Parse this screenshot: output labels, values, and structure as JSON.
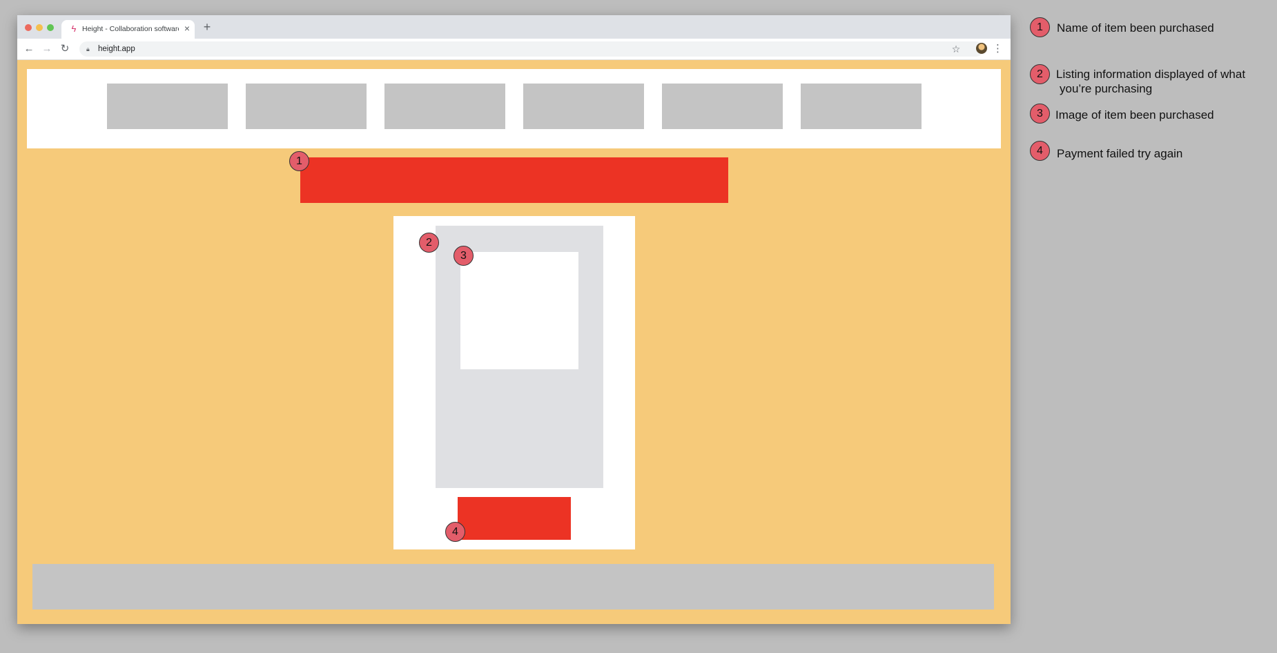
{
  "browser": {
    "tab_title": "Height - Collaboration software th",
    "tab_favicon": "height-logo-icon",
    "url": "height.app",
    "nav_icons": [
      "back-arrow-icon",
      "forward-arrow-icon",
      "reload-icon",
      "lock-icon",
      "star-icon",
      "menu-icon"
    ]
  },
  "wireframe": {
    "nav_item_count": 6,
    "colors": {
      "page_background": "#f6ca7a",
      "placeholder_gray": "#c4c4c4",
      "listing_panel": "#dfe0e3",
      "accent_red": "#ec3324",
      "marker_fill": "#e35d6a"
    }
  },
  "markers": [
    "1",
    "2",
    "3",
    "4"
  ],
  "legend": [
    {
      "number": "1",
      "text": "Name of item been purchased"
    },
    {
      "number": "2",
      "line1": "Listing information displayed of what",
      "line2": "you’re purchasing"
    },
    {
      "number": "3",
      "text": "Image of item been purchased"
    },
    {
      "number": "4",
      "text": "Payment failed try again"
    }
  ]
}
